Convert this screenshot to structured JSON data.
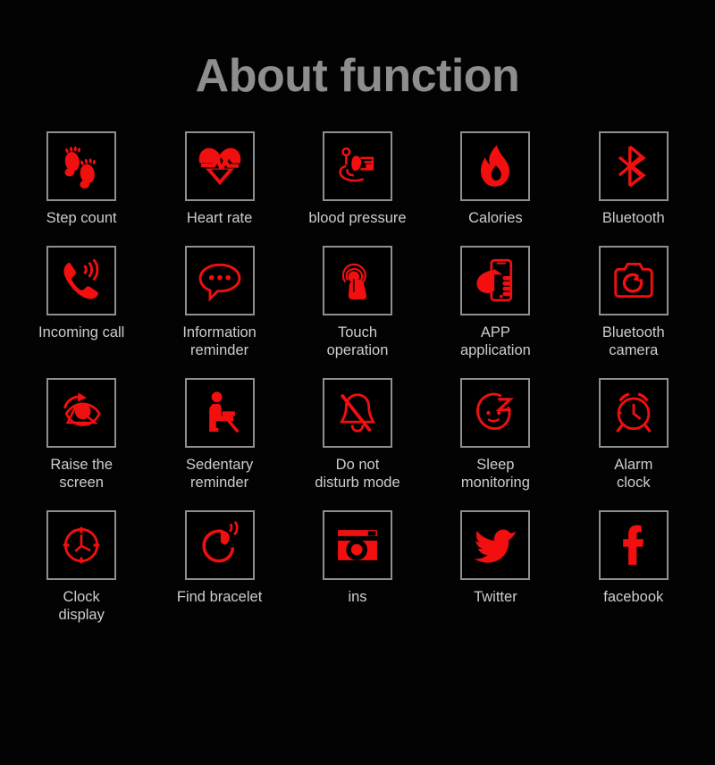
{
  "header": {
    "title": "About function",
    "title_color": "#8e8e8e"
  },
  "theme": {
    "background": "#030303",
    "icon_color": "#f20f10",
    "box_border": "#8f8f8f",
    "label_color": "#cdcdcd"
  },
  "grid": {
    "columns": 5,
    "rows": 4,
    "items": [
      {
        "label": "Step count",
        "icon": "footprints-icon"
      },
      {
        "label": "Heart rate",
        "icon": "heart-pulse-icon"
      },
      {
        "label": "blood pressure",
        "icon": "blood-pressure-monitor-icon"
      },
      {
        "label": "Calories",
        "icon": "flame-icon"
      },
      {
        "label": "Bluetooth",
        "icon": "bluetooth-icon"
      },
      {
        "label": "Incoming call",
        "icon": "ringing-phone-icon"
      },
      {
        "label": "Information\nreminder",
        "icon": "speech-bubble-dots-icon"
      },
      {
        "label": "Touch\noperation",
        "icon": "touch-gesture-icon"
      },
      {
        "label": "APP\napplication",
        "icon": "hand-holding-phone-icon"
      },
      {
        "label": "Bluetooth\ncamera",
        "icon": "camera-icon"
      },
      {
        "label": "Raise the\nscreen",
        "icon": "eye-rotate-icon"
      },
      {
        "label": "Sedentary\nreminder",
        "icon": "seated-person-icon"
      },
      {
        "label": "Do not\ndisturb mode",
        "icon": "bell-slash-icon"
      },
      {
        "label": "Sleep\nmonitoring",
        "icon": "sleeping-face-z-icon"
      },
      {
        "label": "Alarm\nclock",
        "icon": "alarm-clock-icon"
      },
      {
        "label": "Clock\ndisplay",
        "icon": "clock-dial-icon"
      },
      {
        "label": "Find bracelet",
        "icon": "vibrating-bracelet-icon"
      },
      {
        "label": "ins",
        "icon": "instagram-icon"
      },
      {
        "label": "Twitter",
        "icon": "twitter-bird-icon"
      },
      {
        "label": "facebook",
        "icon": "facebook-f-icon"
      }
    ]
  }
}
